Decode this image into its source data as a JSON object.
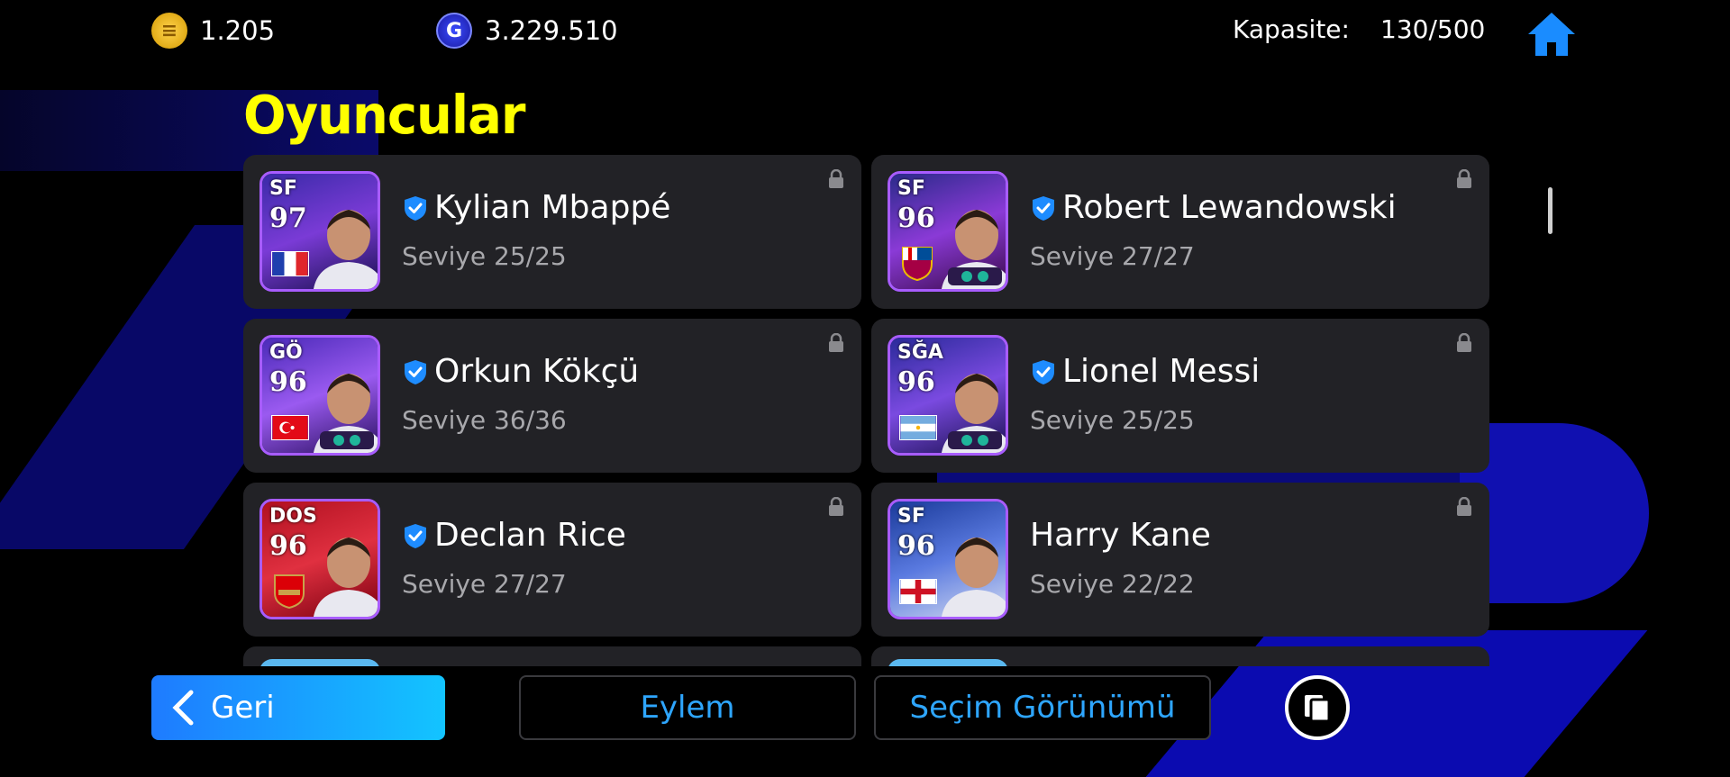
{
  "currency": {
    "coins": "1.205",
    "gp": "3.229.510"
  },
  "capacity": {
    "label": "Kapasite:",
    "value": "130/500"
  },
  "title": "Oyuncular",
  "players": [
    {
      "name": "Kylian Mbappé",
      "level": "Seviye 25/25",
      "position": "SF",
      "rating": "97",
      "verified": true,
      "flag": "france"
    },
    {
      "name": "Robert Lewandowski",
      "level": "Seviye 27/27",
      "position": "SF",
      "rating": "96",
      "verified": true,
      "flag": "barcelona-badge"
    },
    {
      "name": "Orkun Kökçü",
      "level": "Seviye 36/36",
      "position": "GÖ",
      "rating": "96",
      "verified": true,
      "flag": "turkey"
    },
    {
      "name": "Lionel Messi",
      "level": "Seviye 25/25",
      "position": "SĞA",
      "rating": "96",
      "verified": true,
      "flag": "argentina"
    },
    {
      "name": "Declan Rice",
      "level": "Seviye 27/27",
      "position": "DOS",
      "rating": "96",
      "verified": true,
      "flag": "arsenal-badge"
    },
    {
      "name": "Harry Kane",
      "level": "Seviye 22/22",
      "position": "SF",
      "rating": "96",
      "verified": false,
      "flag": "england"
    }
  ],
  "buttons": {
    "back": "Geri",
    "action": "Eylem",
    "selection_view": "Seçim Görünümü"
  },
  "colors": {
    "title": "#ffff00",
    "accent": "#2ea6ff",
    "card": "#222226",
    "card_border": "#a85cff"
  }
}
